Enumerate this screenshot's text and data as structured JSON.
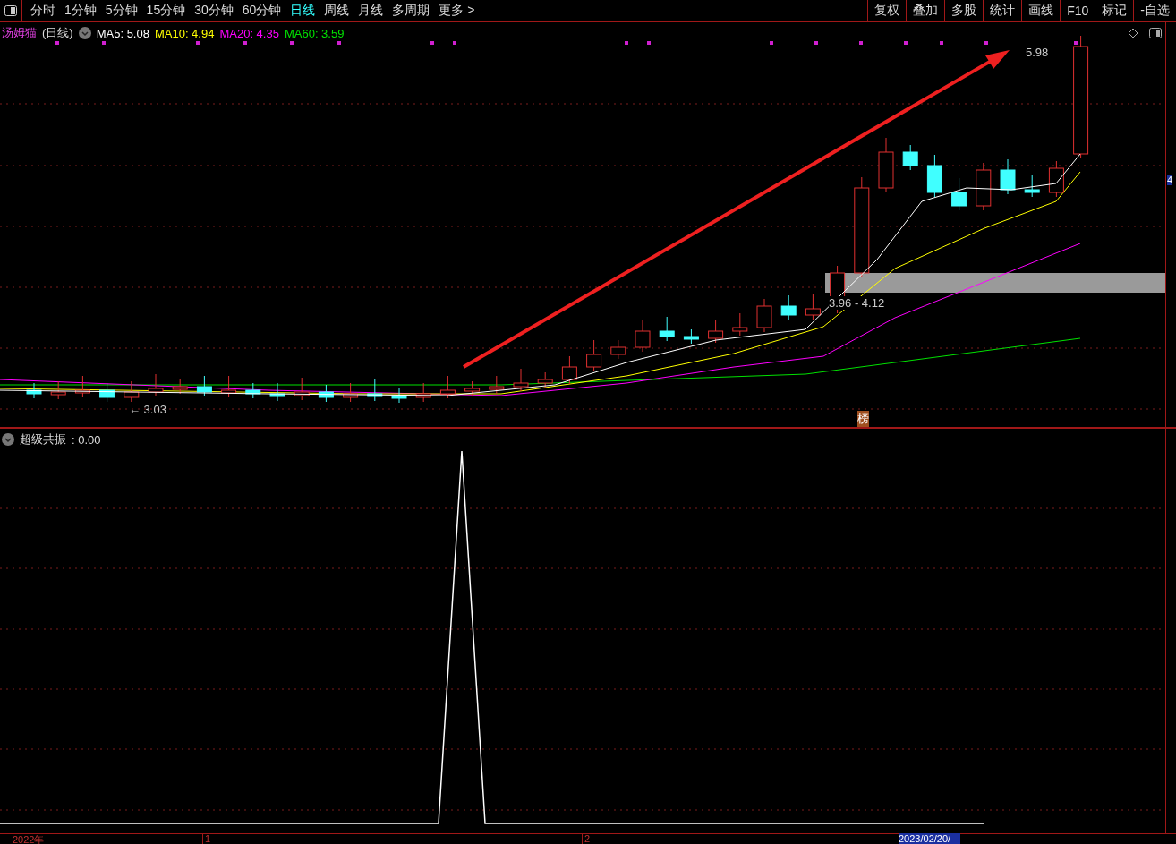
{
  "toolbar": {
    "periods": [
      {
        "label": "分时",
        "selected": false
      },
      {
        "label": "1分钟",
        "selected": false
      },
      {
        "label": "5分钟",
        "selected": false
      },
      {
        "label": "15分钟",
        "selected": false
      },
      {
        "label": "30分钟",
        "selected": false
      },
      {
        "label": "60分钟",
        "selected": false
      },
      {
        "label": "日线",
        "selected": true
      },
      {
        "label": "周线",
        "selected": false
      },
      {
        "label": "月线",
        "selected": false
      },
      {
        "label": "多周期",
        "selected": false
      },
      {
        "label": "更多 >",
        "selected": false
      }
    ],
    "buttons": [
      "复权",
      "叠加",
      "多股",
      "统计",
      "画线",
      "F10",
      "标记",
      "-自选"
    ]
  },
  "price_chart": {
    "stock_name": "汤姆猫",
    "period": "(日线)",
    "moving_averages": [
      {
        "label": "MA5: 5.08",
        "color": "#ffffff"
      },
      {
        "label": "MA10: 4.94",
        "color": "#ffff00"
      },
      {
        "label": "MA20: 4.35",
        "color": "#ff00ff"
      },
      {
        "label": "MA60: 3.59",
        "color": "#00e000"
      }
    ],
    "high_label": "5.98",
    "low_label": "← 3.03",
    "zone_label": "3.96 - 4.12",
    "badge": "榜",
    "axis_label": "4"
  },
  "indicator": {
    "name": "超级共振",
    "value": ": 0.00"
  },
  "time_axis": [
    "2022年",
    "1",
    "2"
  ],
  "cursor_date": "2023/02/20/—"
}
